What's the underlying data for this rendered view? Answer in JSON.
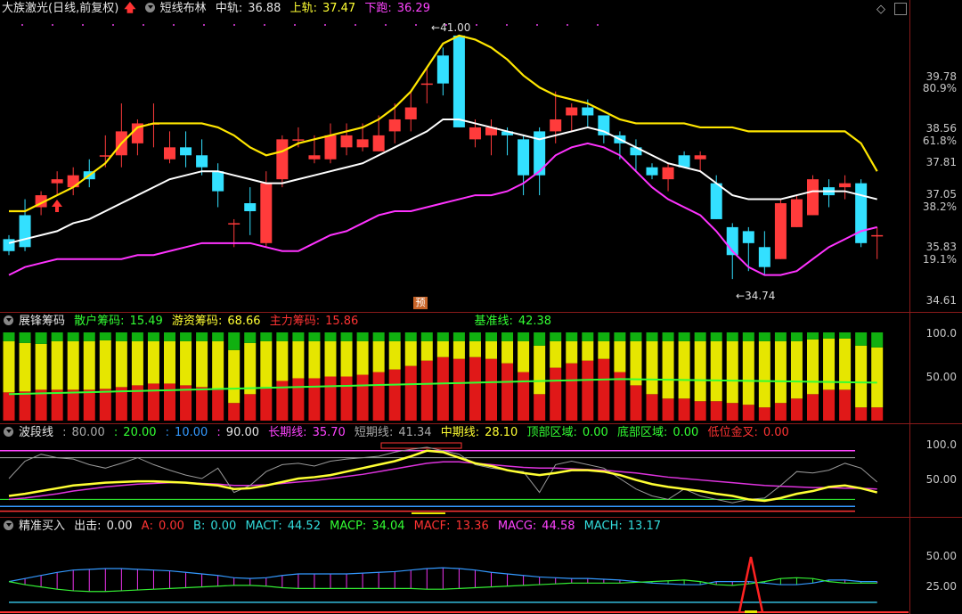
{
  "main": {
    "title": "大族激光(日线,前复权)",
    "arrow_icon": "up-arrow-icon",
    "indicator": "短线布林",
    "mid_label": "中轨",
    "mid_value": "36.88",
    "up_label": "上轨",
    "up_value": "37.47",
    "down_label": "下跑",
    "down_value": "36.29",
    "high_mark": "41.00",
    "low_mark": "34.74",
    "yu_label": "预",
    "price_ticks": [
      "39.78",
      "38.56",
      "37.81",
      "37.05",
      "35.83",
      "34.61"
    ],
    "pct_ticks": [
      "80.9%",
      "61.8%",
      "38.2%",
      "19.1%"
    ],
    "colors": {
      "up": "#ff3b3b",
      "down": "#33e0ff",
      "mid": "#ffffff",
      "upper": "#ffe600",
      "lower": "#ff33ff"
    }
  },
  "chips": {
    "title": "展锋筹码",
    "retail_label": "散户筹码",
    "retail_value": "15.49",
    "hot_label": "游资筹码",
    "hot_value": "68.66",
    "main_label": "主力筹码",
    "main_value": "15.86",
    "base_label": "基准线",
    "base_value": "42.38",
    "ticks": [
      "100.0",
      "50.00"
    ]
  },
  "wave": {
    "title": "波段线",
    "v1": "80.00",
    "v2": "20.00",
    "v3": "10.00",
    "v4": "90.00",
    "long_label": "长期线",
    "long_value": "35.70",
    "short_label": "短期线",
    "short_value": "41.34",
    "mid_label": "中期线",
    "mid_value": "28.10",
    "top_label": "顶部区域",
    "top_value": "0.00",
    "bottom_label": "底部区域",
    "bottom_value": "0.00",
    "cross_label": "低位金叉",
    "cross_value": "0.00",
    "ticks": [
      "100.0",
      "50.00"
    ]
  },
  "buy": {
    "title": "精准买入",
    "out_label": "出击",
    "out_value": "0.00",
    "a_label": "A",
    "a_value": "0.00",
    "b_label": "B",
    "b_value": "0.00",
    "mact_label": "MACT",
    "mact_value": "44.52",
    "macp_label": "MACP",
    "macp_value": "34.04",
    "macf_label": "MACF",
    "macf_value": "13.36",
    "macg_label": "MACG",
    "macg_value": "44.58",
    "mach_label": "MACH",
    "mach_value": "13.17",
    "ticks": [
      "50.00",
      "25.00"
    ]
  },
  "chart_data": {
    "type": "candlestick",
    "ohlc": [
      [
        35.9,
        35.6,
        36.0,
        35.5
      ],
      [
        36.5,
        35.7,
        36.9,
        35.6
      ],
      [
        36.7,
        37.0,
        37.1,
        36.5
      ],
      [
        37.3,
        37.4,
        37.6,
        37.0
      ],
      [
        37.2,
        37.5,
        37.7,
        37.0
      ],
      [
        37.6,
        37.4,
        37.9,
        37.2
      ],
      [
        38.0,
        38.0,
        38.5,
        37.7
      ],
      [
        38.0,
        38.6,
        39.3,
        37.7
      ],
      [
        38.3,
        38.8,
        38.9,
        38.0
      ],
      [
        38.8,
        38.8,
        39.3,
        38.2
      ],
      [
        37.9,
        38.2,
        38.6,
        37.8
      ],
      [
        38.2,
        38.0,
        38.6,
        37.7
      ],
      [
        38.0,
        37.7,
        38.4,
        37.5
      ],
      [
        37.6,
        37.1,
        37.8,
        36.7
      ],
      [
        36.3,
        36.3,
        36.4,
        35.7
      ],
      [
        36.8,
        36.6,
        37.2,
        36.0
      ],
      [
        35.8,
        37.3,
        37.6,
        35.7
      ],
      [
        37.4,
        38.4,
        38.5,
        37.2
      ],
      [
        38.4,
        38.4,
        38.7,
        38.2
      ],
      [
        37.9,
        38.0,
        38.5,
        37.8
      ],
      [
        37.9,
        38.5,
        38.8,
        37.8
      ],
      [
        38.2,
        38.5,
        38.8,
        38.0
      ],
      [
        38.2,
        38.4,
        38.8,
        38.1
      ],
      [
        38.1,
        38.5,
        39.0,
        38.1
      ],
      [
        38.6,
        38.9,
        39.3,
        38.3
      ],
      [
        38.9,
        39.2,
        39.6,
        38.6
      ],
      [
        39.8,
        39.8,
        40.2,
        39.3
      ],
      [
        40.5,
        39.8,
        40.7,
        39.5
      ],
      [
        41.0,
        38.7,
        41.0,
        38.7
      ],
      [
        38.4,
        38.7,
        38.9,
        38.2
      ],
      [
        38.5,
        38.7,
        38.9,
        38.0
      ],
      [
        38.6,
        38.5,
        38.7,
        38.0
      ],
      [
        38.4,
        37.5,
        38.5,
        37.0
      ],
      [
        38.6,
        37.5,
        38.7,
        37.0
      ],
      [
        38.6,
        38.9,
        39.6,
        38.3
      ],
      [
        39.0,
        39.2,
        39.3,
        38.6
      ],
      [
        39.2,
        39.0,
        39.4,
        38.7
      ],
      [
        39.0,
        38.5,
        39.0,
        38.3
      ],
      [
        38.5,
        38.3,
        38.6,
        37.9
      ],
      [
        38.2,
        38.0,
        38.4,
        37.6
      ],
      [
        37.7,
        37.5,
        37.8,
        37.4
      ],
      [
        37.4,
        37.7,
        37.8,
        37.1
      ],
      [
        38.0,
        37.7,
        38.1,
        37.7
      ],
      [
        37.9,
        38.0,
        38.1,
        37.6
      ],
      [
        37.3,
        36.4,
        37.5,
        36.4
      ],
      [
        36.2,
        35.5,
        36.3,
        34.9
      ],
      [
        36.1,
        35.8,
        36.2,
        35.1
      ],
      [
        35.7,
        35.2,
        36.1,
        35.0
      ],
      [
        35.4,
        36.8,
        36.9,
        35.4
      ],
      [
        36.2,
        36.9,
        37.0,
        36.2
      ],
      [
        36.5,
        37.4,
        37.5,
        36.5
      ],
      [
        37.2,
        37.0,
        37.4,
        36.7
      ],
      [
        37.2,
        37.3,
        37.5,
        36.9
      ],
      [
        37.3,
        35.8,
        37.4,
        35.7
      ],
      [
        36.0,
        36.0,
        36.2,
        35.4
      ]
    ],
    "upper": [
      36.6,
      36.6,
      36.8,
      37.0,
      37.2,
      37.5,
      37.8,
      38.3,
      38.7,
      38.8,
      38.8,
      38.8,
      38.8,
      38.7,
      38.5,
      38.2,
      38.0,
      38.1,
      38.3,
      38.4,
      38.5,
      38.6,
      38.7,
      38.9,
      39.2,
      39.6,
      40.2,
      40.8,
      41.0,
      40.9,
      40.7,
      40.4,
      40.0,
      39.7,
      39.5,
      39.4,
      39.3,
      39.1,
      38.9,
      38.8,
      38.8,
      38.8,
      38.8,
      38.7,
      38.7,
      38.7,
      38.6,
      38.6,
      38.6,
      38.6,
      38.6,
      38.6,
      38.6,
      38.3,
      37.6
    ],
    "mid": [
      35.8,
      35.9,
      36.0,
      36.1,
      36.3,
      36.4,
      36.6,
      36.8,
      37.0,
      37.2,
      37.4,
      37.5,
      37.6,
      37.6,
      37.5,
      37.4,
      37.3,
      37.3,
      37.4,
      37.5,
      37.6,
      37.7,
      37.8,
      38.0,
      38.2,
      38.4,
      38.6,
      38.9,
      38.9,
      38.8,
      38.7,
      38.6,
      38.5,
      38.4,
      38.5,
      38.6,
      38.7,
      38.6,
      38.4,
      38.2,
      38.0,
      37.8,
      37.7,
      37.6,
      37.3,
      37.0,
      36.9,
      36.9,
      36.9,
      37.0,
      37.1,
      37.1,
      37.1,
      37.0,
      36.9
    ],
    "lower": [
      35.0,
      35.2,
      35.3,
      35.4,
      35.4,
      35.4,
      35.4,
      35.4,
      35.5,
      35.5,
      35.6,
      35.7,
      35.8,
      35.8,
      35.8,
      35.8,
      35.7,
      35.6,
      35.6,
      35.8,
      36.0,
      36.1,
      36.3,
      36.5,
      36.6,
      36.6,
      36.7,
      36.8,
      36.9,
      37.0,
      37.0,
      37.1,
      37.3,
      37.6,
      38.0,
      38.2,
      38.3,
      38.2,
      38.0,
      37.6,
      37.2,
      36.9,
      36.7,
      36.5,
      36.1,
      35.6,
      35.2,
      35.0,
      35.0,
      35.1,
      35.4,
      35.7,
      35.9,
      36.1,
      36.2
    ],
    "ylim": [
      34.3,
      41.4
    ]
  }
}
